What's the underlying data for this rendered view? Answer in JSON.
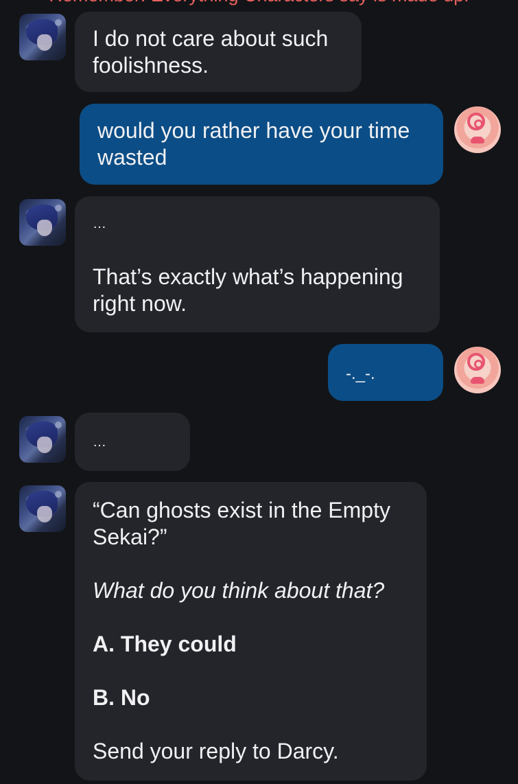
{
  "header": {
    "disclaimer": "Remember: Everything Characters say is made up!"
  },
  "messages": [
    {
      "sender": "bot",
      "avatar_icon": "character-avatar-icon",
      "lines": [
        "I do not care about such foolishness."
      ]
    },
    {
      "sender": "user",
      "avatar_icon": "user-avatar-icon",
      "lines": [
        "would you rather have your time wasted"
      ]
    },
    {
      "sender": "bot",
      "avatar_icon": "character-avatar-icon",
      "lines": [
        "…",
        "That’s exactly what’s happening right now."
      ]
    },
    {
      "sender": "user",
      "avatar_icon": "user-avatar-icon",
      "lines": [
        "-._-."
      ]
    },
    {
      "sender": "bot",
      "avatar_icon": "character-avatar-icon",
      "lines": [
        "…"
      ]
    },
    {
      "sender": "bot",
      "avatar_icon": "character-avatar-icon",
      "lines": [
        "“Can ghosts exist in the Empty Sekai?”",
        "What do you think about that?",
        "A. They could",
        "B. No",
        "Send your reply to Darcy."
      ]
    }
  ],
  "colors": {
    "background": "#131417",
    "bot_bubble": "#23252b",
    "user_bubble": "#0b4d86",
    "disclaimer": "#e8615f"
  }
}
